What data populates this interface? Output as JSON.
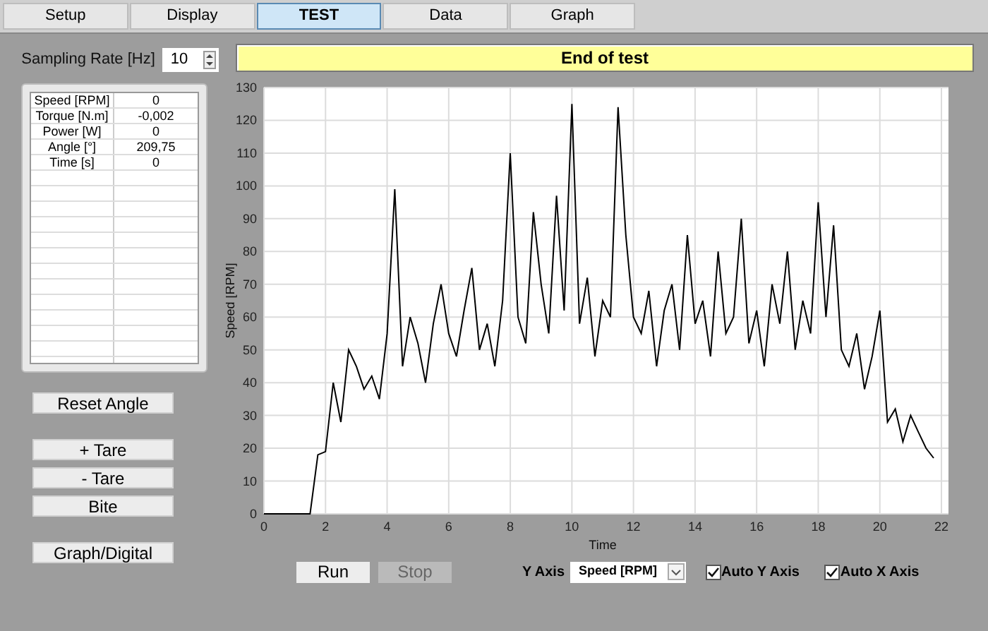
{
  "tabs": [
    {
      "label": "Setup",
      "selected": false
    },
    {
      "label": "Display",
      "selected": false
    },
    {
      "label": "TEST",
      "selected": true
    },
    {
      "label": "Data",
      "selected": false
    },
    {
      "label": "Graph",
      "selected": false
    }
  ],
  "sampling_rate": {
    "label": "Sampling Rate [Hz]",
    "value": "10"
  },
  "status": "End of test",
  "readings": [
    {
      "name": "Speed [RPM]",
      "value": "0"
    },
    {
      "name": "Torque [N.m]",
      "value": "-0,002"
    },
    {
      "name": "Power [W]",
      "value": "0"
    },
    {
      "name": "Angle [°]",
      "value": "209,75"
    },
    {
      "name": "Time [s]",
      "value": "0"
    }
  ],
  "side_buttons": [
    "Reset Angle",
    "+ Tare",
    "- Tare",
    "Bite",
    "Graph/Digital"
  ],
  "chart_data": {
    "type": "line",
    "grid": true,
    "xlabel": "Time",
    "ylabel": "Speed [RPM]",
    "xlim": [
      0,
      22
    ],
    "ylim": [
      0,
      130
    ],
    "xticks": [
      0,
      2,
      4,
      6,
      8,
      10,
      12,
      14,
      16,
      18,
      20,
      22
    ],
    "yticks": [
      0,
      10,
      20,
      30,
      40,
      50,
      60,
      70,
      80,
      90,
      100,
      110,
      120,
      130
    ],
    "x": [
      0,
      0.25,
      0.5,
      0.75,
      1,
      1.25,
      1.5,
      1.75,
      2,
      2.25,
      2.5,
      2.75,
      3,
      3.25,
      3.5,
      3.75,
      4,
      4.25,
      4.5,
      4.75,
      5,
      5.25,
      5.5,
      5.75,
      6,
      6.25,
      6.5,
      6.75,
      7,
      7.25,
      7.5,
      7.75,
      8,
      8.25,
      8.5,
      8.75,
      9,
      9.25,
      9.5,
      9.75,
      10,
      10.25,
      10.5,
      10.75,
      11,
      11.25,
      11.5,
      11.75,
      12,
      12.25,
      12.5,
      12.75,
      13,
      13.25,
      13.5,
      13.75,
      14,
      14.25,
      14.5,
      14.75,
      15,
      15.25,
      15.5,
      15.75,
      16,
      16.25,
      16.5,
      16.75,
      17,
      17.25,
      17.5,
      17.75,
      18,
      18.25,
      18.5,
      18.75,
      19,
      19.25,
      19.5,
      19.75,
      20,
      20.25,
      20.5,
      20.75,
      21,
      21.25,
      21.5,
      21.75
    ],
    "series": [
      {
        "color": "#000000",
        "values": [
          0,
          0,
          0,
          0,
          0,
          0,
          0,
          18,
          19,
          40,
          28,
          50,
          45,
          38,
          42,
          35,
          55,
          99,
          45,
          60,
          52,
          40,
          58,
          70,
          55,
          48,
          62,
          75,
          50,
          58,
          45,
          65,
          110,
          60,
          52,
          92,
          70,
          55,
          97,
          62,
          125,
          58,
          72,
          48,
          65,
          60,
          124,
          85,
          60,
          55,
          68,
          45,
          62,
          70,
          50,
          85,
          58,
          65,
          48,
          80,
          55,
          60,
          90,
          52,
          62,
          45,
          70,
          58,
          80,
          50,
          65,
          55,
          95,
          60,
          88,
          50,
          45,
          55,
          38,
          48,
          62,
          28,
          32,
          22,
          30,
          25,
          20,
          17
        ]
      }
    ]
  },
  "controls": {
    "run": {
      "label": "Run",
      "disabled": false
    },
    "stop": {
      "label": "Stop",
      "disabled": true
    },
    "y_axis": {
      "label": "Y Axis",
      "value": "Speed [RPM]"
    },
    "checkboxes": [
      {
        "label": "Auto Y Axis",
        "checked": true
      },
      {
        "label": "Auto X Axis",
        "checked": true
      }
    ]
  }
}
